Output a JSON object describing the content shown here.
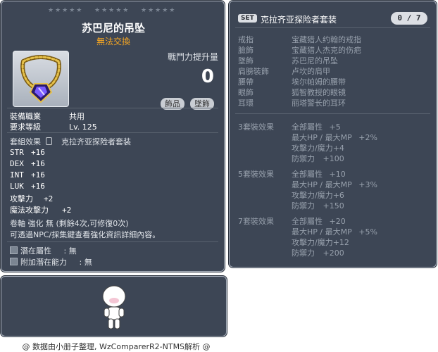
{
  "item": {
    "id": "01122352",
    "stars": [
      "★★★★★",
      "★★★★★",
      "★★★★★"
    ],
    "name": "苏巴尼的吊坠",
    "trade": "無法交換",
    "power_label": "戰鬥力提升量",
    "power_value": "0",
    "tags": [
      "飾品",
      "墜飾"
    ],
    "job_label": "裝備職業",
    "job_value": "共用",
    "level_label": "要求等級",
    "level_value": "Lv. 125",
    "set_effect_label": "套組效果",
    "set_name": "克拉齐亚探险者套装",
    "stats": [
      {
        "k": "STR",
        "v": "+16"
      },
      {
        "k": "DEX",
        "v": "+16"
      },
      {
        "k": "INT",
        "v": "+16"
      },
      {
        "k": "LUK",
        "v": "+16"
      }
    ],
    "atk": {
      "k": "攻擊力",
      "v": "+2"
    },
    "matk": {
      "k": "魔法攻擊力",
      "v": "+2"
    },
    "scroll_line": "卷軸 強化 無 (剩餘4次,可修復0次)",
    "info_line": "可透過NPC/採集鍵查看強化資訊詳細內容。",
    "potential_label": "潛在屬性",
    "potential_value": ": 無",
    "add_potential_label": "附加潛在能力",
    "add_potential_value": ": 無"
  },
  "set": {
    "badge": "SET",
    "name": "克拉齐亚探险者套装",
    "count": "0 / 7",
    "parts": [
      {
        "slot": "戒指",
        "name": "宝藏猎人约翰的戒指"
      },
      {
        "slot": "臉飾",
        "name": "宝藏猎人杰克的伤疤"
      },
      {
        "slot": "墜飾",
        "name": "苏巴尼的吊坠"
      },
      {
        "slot": "肩膀裝飾",
        "name": "卢坎的肩甲"
      },
      {
        "slot": "腰帶",
        "name": "埃尔帕姆的腰带"
      },
      {
        "slot": "眼飾",
        "name": "狐智教授的眼镜"
      },
      {
        "slot": "耳環",
        "name": "丽塔警长的耳环"
      }
    ],
    "effects": [
      {
        "title": "3套裝效果",
        "lines": [
          {
            "l": "全部屬性",
            "v": "+5"
          },
          {
            "l": "最大HP / 最大MP",
            "v": "+2%"
          },
          {
            "l": "攻擊力/魔力",
            "v": "+4"
          },
          {
            "l": "防禦力",
            "v": "+100"
          }
        ]
      },
      {
        "title": "5套裝效果",
        "lines": [
          {
            "l": "全部屬性",
            "v": "+10"
          },
          {
            "l": "最大HP / 最大MP",
            "v": "+3%"
          },
          {
            "l": "攻擊力/魔力",
            "v": "+6"
          },
          {
            "l": "防禦力",
            "v": "+150"
          }
        ]
      },
      {
        "title": "7套裝效果",
        "lines": [
          {
            "l": "全部屬性",
            "v": "+20"
          },
          {
            "l": "最大HP / 最大MP",
            "v": "+5%"
          },
          {
            "l": "攻擊力/魔力",
            "v": "+12"
          },
          {
            "l": "防禦力",
            "v": "+200"
          }
        ]
      }
    ]
  },
  "footer": "@ 数据由小册子整理, WzComparerR2-NTMS解析 @"
}
